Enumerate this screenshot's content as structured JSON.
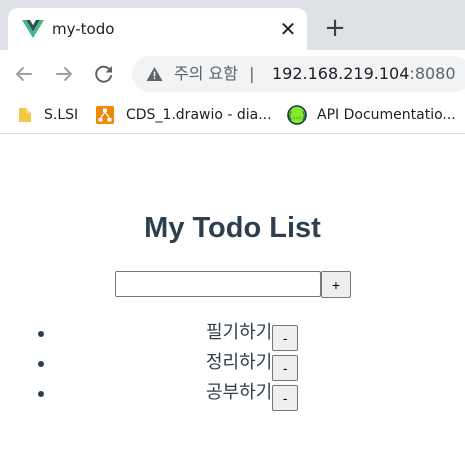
{
  "browser": {
    "tab": {
      "title": "my-todo",
      "favicon": "vue-logo-icon",
      "close_label": "✕"
    },
    "new_tab_label": "+",
    "address_bar": {
      "security_label": "주의 요함",
      "separator": "|",
      "host": "192.168.219.104",
      "port": ":8080"
    },
    "bookmarks": [
      {
        "label": "S.LSI",
        "icon": "folder-icon"
      },
      {
        "label": "CDS_1.drawio - dia...",
        "icon": "drawio-icon"
      },
      {
        "label": "API Documentatio...",
        "icon": "api-icon"
      }
    ]
  },
  "app": {
    "title": "My Todo List",
    "new_todo": {
      "value": "",
      "placeholder": ""
    },
    "add_button_label": "+",
    "todos": [
      {
        "text": "필기하기",
        "delete_label": "-"
      },
      {
        "text": "정리하기",
        "delete_label": "-"
      },
      {
        "text": "공부하기",
        "delete_label": "-"
      }
    ]
  },
  "colors": {
    "heading": "#2c3e50",
    "tab_strip": "#dee1e6",
    "omnibox": "#f1f3f4"
  }
}
